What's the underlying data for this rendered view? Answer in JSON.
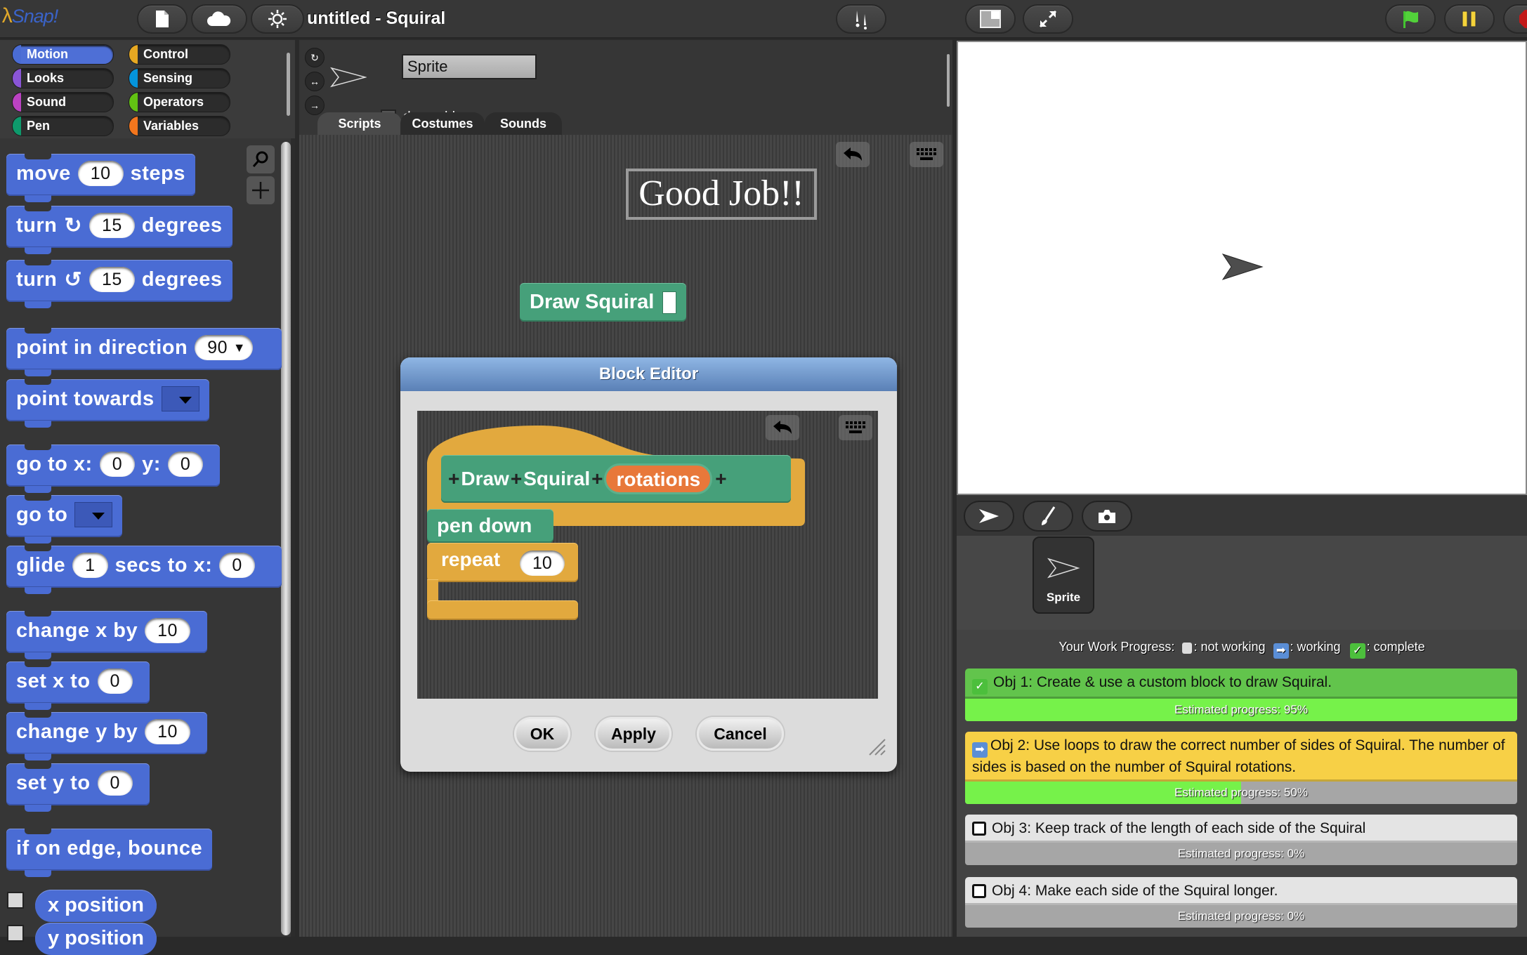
{
  "app": {
    "logo_text": "Snap!",
    "project_title": "untitled - Squiral"
  },
  "toolbar": {
    "buttons": [
      {
        "name": "file-icon"
      },
      {
        "name": "cloud-icon"
      },
      {
        "name": "settings-icon"
      },
      {
        "name": "turbo-footprints-icon"
      },
      {
        "name": "stage-size-icon"
      },
      {
        "name": "fullscreen-icon"
      },
      {
        "name": "green-flag-icon"
      },
      {
        "name": "pause-icon"
      },
      {
        "name": "stop-icon"
      }
    ]
  },
  "categories": [
    {
      "label": "Motion",
      "color": "#4a6cd4",
      "selected": true
    },
    {
      "label": "Looks",
      "color": "#8a55d7"
    },
    {
      "label": "Sound",
      "color": "#bb42c3"
    },
    {
      "label": "Pen",
      "color": "#0e9a6c"
    },
    {
      "label": "Control",
      "color": "#e6a822"
    },
    {
      "label": "Sensing",
      "color": "#0494dc"
    },
    {
      "label": "Operators",
      "color": "#62c213"
    },
    {
      "label": "Variables",
      "color": "#f3761d"
    }
  ],
  "palette": {
    "move": {
      "pre": "move",
      "val": "10",
      "post": "steps"
    },
    "turn_cw": {
      "pre": "turn",
      "val": "15",
      "post": "degrees"
    },
    "turn_ccw": {
      "pre": "turn",
      "val": "15",
      "post": "degrees"
    },
    "point_dir": {
      "pre": "point in direction",
      "val": "90"
    },
    "point_towards": {
      "pre": "point towards"
    },
    "goto_xy": {
      "pre": "go to x:",
      "x": "0",
      "mid": "y:",
      "y": "0"
    },
    "goto": {
      "pre": "go to"
    },
    "glide": {
      "pre": "glide",
      "secs": "1",
      "mid": "secs to x:",
      "x": "0"
    },
    "change_x": {
      "pre": "change x by",
      "val": "10"
    },
    "set_x": {
      "pre": "set x to",
      "val": "0"
    },
    "change_y": {
      "pre": "change y by",
      "val": "10"
    },
    "set_y": {
      "pre": "set y to",
      "val": "0"
    },
    "bounce": {
      "label": "if on edge, bounce"
    },
    "x_position": {
      "label": "x position"
    },
    "y_position": {
      "label": "y position"
    }
  },
  "sprite": {
    "name": "Sprite",
    "draggable_label": "draggable",
    "draggable": true
  },
  "tabs": [
    {
      "label": "Scripts",
      "selected": true
    },
    {
      "label": "Costumes"
    },
    {
      "label": "Sounds"
    }
  ],
  "scripts": {
    "comment": "Good Job!!",
    "custom_block_label": "Draw Squiral"
  },
  "block_editor": {
    "title": "Block Editor",
    "hat": {
      "words": [
        "Draw",
        "Squiral"
      ],
      "param": "rotations"
    },
    "pen_down": "pen down",
    "repeat": {
      "label": "repeat",
      "val": "10"
    },
    "buttons": {
      "ok": "OK",
      "apply": "Apply",
      "cancel": "Cancel"
    }
  },
  "corral": {
    "sprite_label": "Sprite"
  },
  "progress": {
    "legend": {
      "prefix": "Your Work Progress:",
      "not_working": ": not working",
      "working": ": working",
      "complete": ": complete"
    },
    "objectives": [
      {
        "text": "Obj 1: Create & use a custom block to draw Squiral.",
        "status": "complete",
        "progress_label": "Estimated progress: 95%",
        "progress": 95,
        "color": "#62c44c"
      },
      {
        "text": "Obj 2: Use loops to draw the correct number of sides of Squiral. The number of sides is based on the number of Squiral rotations.",
        "status": "working",
        "progress_label": "Estimated progress: 50%",
        "progress": 50,
        "color": "#f7d046"
      },
      {
        "text": "Obj 3: Keep track of the length of each side of the Squiral",
        "status": "not_working",
        "progress_label": "Estimated progress: 0%",
        "progress": 0,
        "color": "#e4e4e4"
      },
      {
        "text": "Obj 4: Make each side of the Squiral longer.",
        "status": "not_working",
        "progress_label": "Estimated progress: 0%",
        "progress": 0,
        "color": "#e4e4e4"
      }
    ]
  }
}
